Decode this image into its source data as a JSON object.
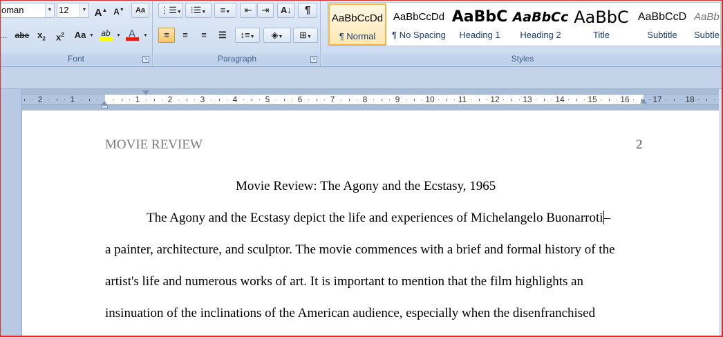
{
  "font_group": {
    "label": "Font",
    "font_name": "oman",
    "font_size": "12",
    "grow_label": "A",
    "shrink_label": "A",
    "clear_label": "Aa",
    "strike_label": "abc",
    "subscript_label": "x",
    "superscript_label": "x",
    "case_label": "Aa",
    "highlight_label": "ab",
    "font_color_label": "A",
    "highlight_color": "#ffff00",
    "font_color": "#e31b1b"
  },
  "paragraph_group": {
    "label": "Paragraph",
    "pilcrow": "¶"
  },
  "styles_group": {
    "label": "Styles",
    "items": [
      {
        "preview": "AaBbCcDd",
        "name": "¶ Normal"
      },
      {
        "preview": "AaBbCcDd",
        "name": "¶ No Spacing"
      },
      {
        "preview": "AaBbC",
        "name": "Heading 1"
      },
      {
        "preview": "AaBbCc",
        "name": "Heading 2"
      },
      {
        "preview": "AaBbC",
        "name": "Title"
      },
      {
        "preview": "AaBbCcD",
        "name": "Subtitle"
      },
      {
        "preview": "AaBb",
        "name": "Subtle"
      }
    ]
  },
  "ruler": {
    "left_numbers": [
      "2",
      "1"
    ],
    "right_numbers": [
      "1",
      "2",
      "3",
      "4",
      "5",
      "6",
      "7",
      "8",
      "9",
      "10",
      "11",
      "12",
      "13",
      "14",
      "15",
      "16",
      "17",
      "18"
    ]
  },
  "document": {
    "running_head": "MOVIE REVIEW",
    "page_number": "2",
    "title": "Movie Review: The Agony and the Ecstasy, 1965",
    "line1_before_caret": "The Agony and the Ecstasy depict the life and experiences of Michelangelo Buonarroti",
    "line1_after_caret": "–",
    "line2": "a painter, architecture, and sculptor. The movie commences with a brief and formal history of the",
    "line3": "artist's life and numerous works of art. It is important to mention that the film highlights an",
    "line4": "insinuation of the inclinations of the American audience, especially when the disenfranchised"
  },
  "icons": [
    "grow-font-icon",
    "shrink-font-icon",
    "clear-formatting-icon",
    "bullets-icon",
    "numbering-icon",
    "multilevel-list-icon",
    "decrease-indent-icon",
    "increase-indent-icon",
    "sort-icon",
    "show-formatting-icon",
    "align-left-icon",
    "align-center-icon",
    "align-right-icon",
    "justify-icon",
    "line-spacing-icon",
    "shading-icon",
    "borders-icon",
    "dialog-launcher-icon"
  ]
}
